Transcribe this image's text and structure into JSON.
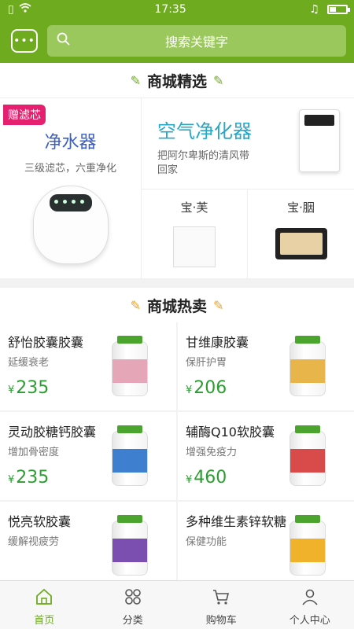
{
  "status_bar": {
    "time": "17:35"
  },
  "header": {
    "search_placeholder": "搜索关键字"
  },
  "featured": {
    "title": "商城精选",
    "water": {
      "tag": "赠滤芯",
      "title": "净水器",
      "subtitle": "三级滤芯，六重净化"
    },
    "air": {
      "title": "空气净化器",
      "subtitle": "把阿尔卑斯的清风带回家"
    },
    "item1": {
      "title": "宝·芙"
    },
    "item2": {
      "title": "宝·胭"
    }
  },
  "hot": {
    "title": "商城热卖",
    "products": [
      {
        "name": "舒怡胶囊胶囊",
        "desc": "延缓衰老",
        "currency": "¥",
        "price": "235",
        "color": "#e5a7b8"
      },
      {
        "name": "甘维康胶囊",
        "desc": "保肝护胃",
        "currency": "¥",
        "price": "206",
        "color": "#e7b54a"
      },
      {
        "name": "灵动胶糖钙胶囊",
        "desc": "增加骨密度",
        "currency": "¥",
        "price": "235",
        "color": "#3f7fd0"
      },
      {
        "name": "辅酶Q10软胶囊",
        "desc": "增强免疫力",
        "currency": "¥",
        "price": "460",
        "color": "#d94b4b"
      },
      {
        "name": "悦亮软胶囊",
        "desc": "缓解视疲劳",
        "currency": "",
        "price": "",
        "color": "#7a4fb0"
      },
      {
        "name": "多种维生素锌软糖",
        "desc": "保健功能",
        "currency": "",
        "price": "",
        "color": "#f0b22a"
      }
    ]
  },
  "tabbar": {
    "items": [
      {
        "label": "首页",
        "icon": "home-icon"
      },
      {
        "label": "分类",
        "icon": "category-icon"
      },
      {
        "label": "购物车",
        "icon": "cart-icon"
      },
      {
        "label": "个人中心",
        "icon": "user-icon"
      }
    ]
  }
}
